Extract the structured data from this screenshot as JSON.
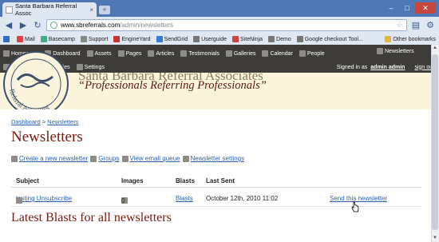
{
  "browser": {
    "tab_title": "Santa Barbara Referral Assoc",
    "tab_close": "×",
    "new_tab": "+",
    "url_host": "www.sbreferrals.com",
    "url_path": "/admin/newsletters",
    "bookmarks": [
      {
        "label": "",
        "color": "#3a6bc4"
      },
      {
        "label": "Mail",
        "color": "#d44"
      },
      {
        "label": "Basecamp",
        "color": "#4a8"
      },
      {
        "label": "Support",
        "color": "#888"
      },
      {
        "label": "EngineYard",
        "color": "#c33"
      },
      {
        "label": "SendGrid",
        "color": "#3a7bd5"
      },
      {
        "label": "Userguide",
        "color": "#777"
      },
      {
        "label": "SiteNinja",
        "color": "#c44"
      },
      {
        "label": "Demo",
        "color": "#777"
      },
      {
        "label": "Google checkout Tool...",
        "color": "#777"
      }
    ],
    "other_bookmarks": "Other bookmarks"
  },
  "admin_nav": {
    "row1": [
      {
        "label": "Homepage"
      },
      {
        "label": "Dashboard"
      },
      {
        "label": "Assets"
      },
      {
        "label": "Pages"
      },
      {
        "label": "Articles"
      },
      {
        "label": "Testimonials"
      },
      {
        "label": "Galleries"
      },
      {
        "label": "Calendar"
      },
      {
        "label": "People"
      }
    ],
    "newsletters": "Newsletters",
    "row2": [
      {
        "label": "Members"
      },
      {
        "label": "Inquiries"
      },
      {
        "label": "Settings"
      }
    ],
    "signed_in_prefix": "Signed in as",
    "signed_in_user": "admin admin",
    "sign_out": "sign out"
  },
  "header": {
    "site_name": "Santa Barbara Referral Associates",
    "tagline": "“Professionals Referring Professionals”",
    "logo_text": "Referral Associates"
  },
  "breadcrumb": {
    "home": "Dashboard",
    "separator": ">",
    "current": "Newsletters"
  },
  "page_title": "Newsletters",
  "actions": [
    {
      "label": "Create a new newsletter"
    },
    {
      "label": "Groups"
    },
    {
      "label": "View email queue"
    },
    {
      "label": "Newsletter settings"
    }
  ],
  "table": {
    "headers": [
      "Subject",
      "Images",
      "Blasts",
      "Last Sent"
    ],
    "rows": [
      {
        "subject": "testing Unsubscribe",
        "images": "0",
        "blasts": "Blasts",
        "last_sent": "October 12th, 2010 11:02",
        "action": "Send this newsletter"
      }
    ]
  },
  "section_title": "Latest Blasts for all newsletters",
  "colors": {
    "nav_bg": "#3e3c38",
    "header_bg": "#fbf4dd",
    "heading_red": "#7a1a0c",
    "link_blue": "#2a5fa5"
  }
}
